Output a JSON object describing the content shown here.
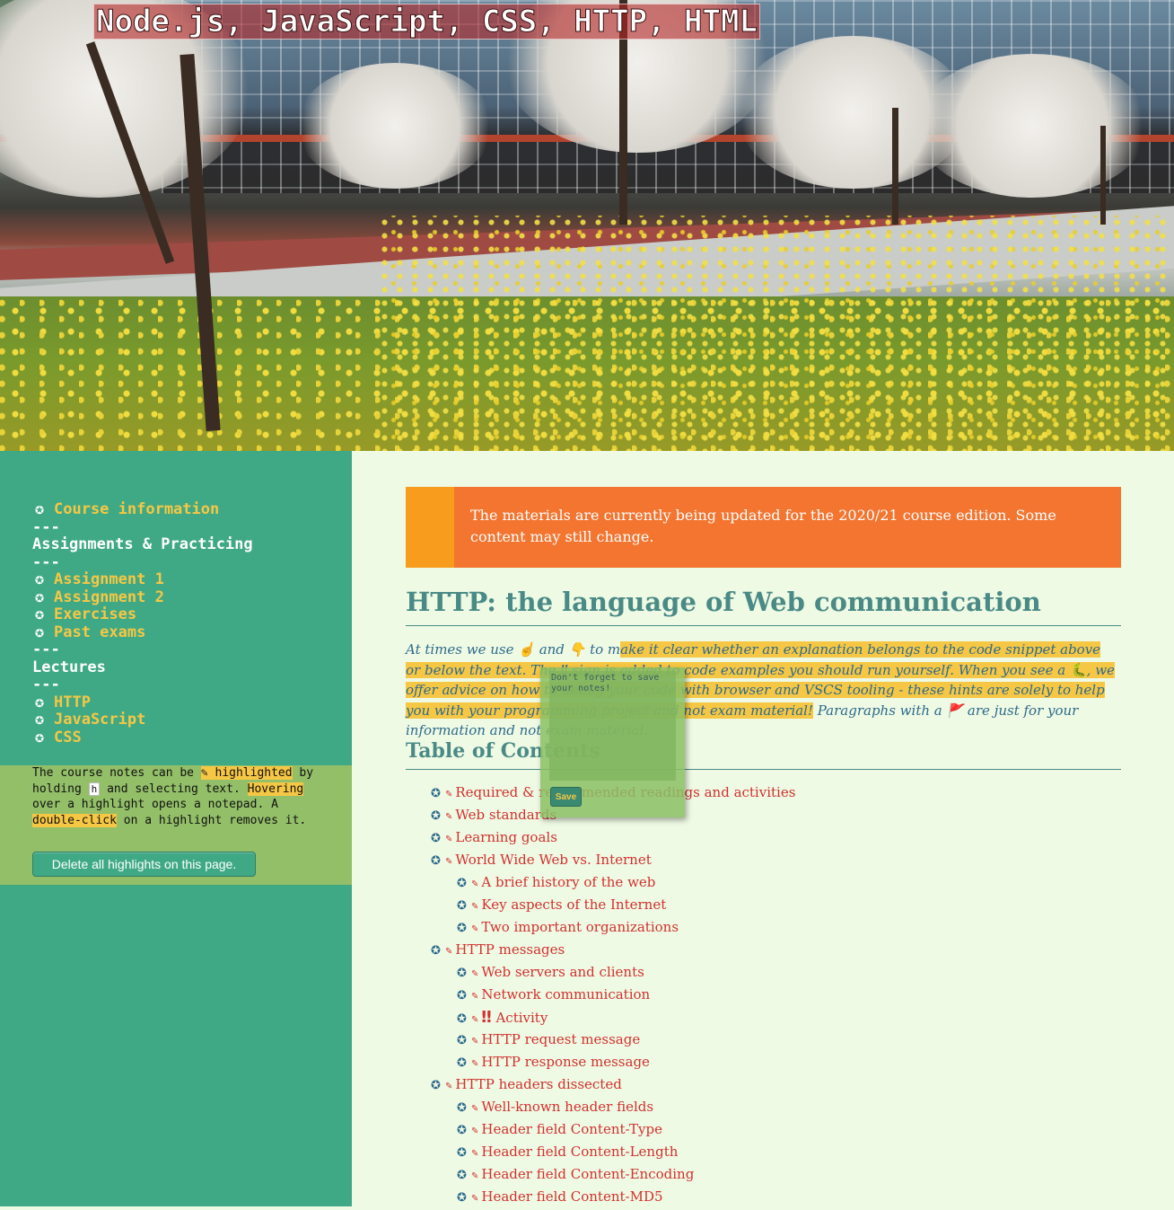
{
  "site": {
    "title": "Node.js, JavaScript, CSS, HTTP, HTML"
  },
  "sidebar": {
    "nav": [
      {
        "type": "link",
        "label": "Course information",
        "icon": "star-icon"
      },
      {
        "type": "sep",
        "label": "---"
      },
      {
        "type": "heading",
        "label": "Assignments & Practicing"
      },
      {
        "type": "sep",
        "label": "---"
      },
      {
        "type": "link",
        "label": "Assignment 1",
        "icon": "star-icon"
      },
      {
        "type": "link",
        "label": "Assignment 2",
        "icon": "star-icon"
      },
      {
        "type": "link",
        "label": "Exercises",
        "icon": "star-icon"
      },
      {
        "type": "link",
        "label": "Past exams",
        "icon": "star-icon"
      },
      {
        "type": "sep",
        "label": "---"
      },
      {
        "type": "heading",
        "label": "Lectures"
      },
      {
        "type": "sep",
        "label": "---"
      },
      {
        "type": "link",
        "label": "HTTP",
        "icon": "star-icon"
      },
      {
        "type": "link",
        "label": "JavaScript",
        "icon": "star-icon"
      },
      {
        "type": "link",
        "label": "CSS",
        "icon": "star-icon"
      }
    ],
    "highlight_help": {
      "t1": "The course notes can be ",
      "m1": "✎ highlighted",
      "t2": " by holding ",
      "key": "h",
      "t3": " and selecting text. ",
      "m2": "Hovering",
      "t4": " over a highlight opens a notepad. A ",
      "m3": "double-click",
      "t5": " on a highlight removes it."
    },
    "delete_button": "Delete all highlights on this page."
  },
  "main": {
    "notice": "The materials are currently being updated for the 2020/21 course edition. Some content may still change.",
    "title": "HTTP: the language of Web communication",
    "intro": {
      "p1": "At times we use ☝ and 👇 to m",
      "hl": "ake it clear whether an explanation belongs to the code snippet above or below the text. The ‼ sign is added to code examples you should run yourself. When you see a 🐛, we offer advice on how to debug your code with browser and VSCS tooling - these hints are solely to help you with your programming project and not exam material!",
      "p2": " Paragraphs with a 🚩 are just for your information and not exam material."
    },
    "toc_title": "Table of Contents",
    "toc": [
      {
        "label": "Required & recommended readings and activities",
        "level": 1
      },
      {
        "label": "Web standards",
        "level": 1
      },
      {
        "label": "Learning goals",
        "level": 1
      },
      {
        "label": "World Wide Web vs. Internet",
        "level": 1
      },
      {
        "label": "A brief history of the web",
        "level": 2
      },
      {
        "label": "Key aspects of the Internet",
        "level": 2
      },
      {
        "label": "Two important organizations",
        "level": 2
      },
      {
        "label": "HTTP messages",
        "level": 1
      },
      {
        "label": "Web servers and clients",
        "level": 2
      },
      {
        "label": "Network communication",
        "level": 2
      },
      {
        "label": "Activity",
        "level": 2,
        "bang": "‼"
      },
      {
        "label": "HTTP request message",
        "level": 2
      },
      {
        "label": "HTTP response message",
        "level": 2
      },
      {
        "label": "HTTP headers dissected",
        "level": 1
      },
      {
        "label": "Well-known header fields",
        "level": 2
      },
      {
        "label": "Header field Content-Type",
        "level": 2
      },
      {
        "label": "Header field Content-Length",
        "level": 2
      },
      {
        "label": "Header field Content-Encoding",
        "level": 2
      },
      {
        "label": "Header field Content-MD5",
        "level": 2
      }
    ]
  },
  "notepad": {
    "placeholder": "Don't forget to save your notes!",
    "save_label": "Save"
  },
  "colors": {
    "sidebar": "#3fa986",
    "accent_link": "#f6c744",
    "toc_link": "#d2312f",
    "heading": "#4a8a86",
    "notice": "#f37530"
  }
}
